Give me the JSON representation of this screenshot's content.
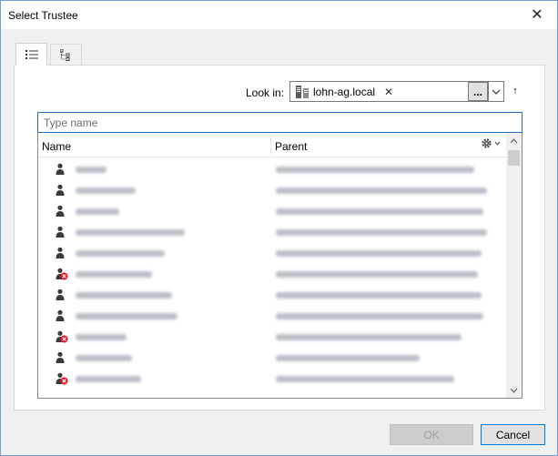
{
  "window": {
    "title": "Select Trustee",
    "close_glyph": "✕"
  },
  "tabs": [
    {
      "icon": "list-view-icon",
      "active": true
    },
    {
      "icon": "tree-view-icon",
      "active": false
    }
  ],
  "lookin": {
    "label": "Look in:",
    "value": "lohn-ag.local",
    "remove_glyph": "✕",
    "browse_label": "...",
    "up_glyph": "↑"
  },
  "search": {
    "placeholder": "Type name",
    "value": ""
  },
  "list": {
    "columns": {
      "name": "Name",
      "parent": "Parent"
    },
    "rows": [
      {
        "icon": "user-icon",
        "disabled": false,
        "name": "",
        "parent": ""
      },
      {
        "icon": "user-icon",
        "disabled": false,
        "name": "",
        "parent": ""
      },
      {
        "icon": "user-icon",
        "disabled": false,
        "name": "",
        "parent": ""
      },
      {
        "icon": "user-icon",
        "disabled": false,
        "name": "",
        "parent": ""
      },
      {
        "icon": "user-icon",
        "disabled": false,
        "name": "",
        "parent": ""
      },
      {
        "icon": "user-disabled-icon",
        "disabled": true,
        "name": "",
        "parent": ""
      },
      {
        "icon": "user-icon",
        "disabled": false,
        "name": "",
        "parent": ""
      },
      {
        "icon": "user-icon",
        "disabled": false,
        "name": "",
        "parent": ""
      },
      {
        "icon": "user-disabled-icon",
        "disabled": true,
        "name": "",
        "parent": ""
      },
      {
        "icon": "user-icon",
        "disabled": false,
        "name": "",
        "parent": ""
      },
      {
        "icon": "user-disabled-icon",
        "disabled": true,
        "name": "",
        "parent": ""
      }
    ]
  },
  "buttons": {
    "ok": "OK",
    "cancel": "Cancel"
  },
  "colors": {
    "accent": "#0078d7",
    "disabled_badge": "#e81123"
  }
}
